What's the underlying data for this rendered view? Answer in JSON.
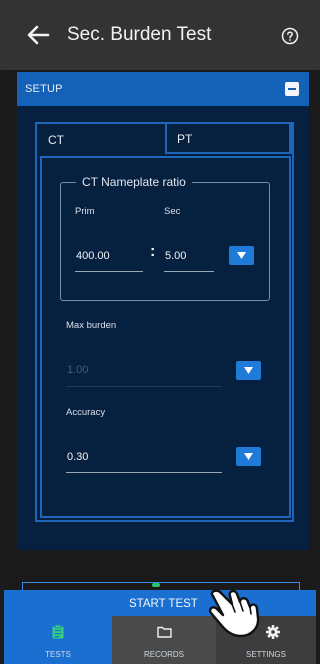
{
  "app_bar": {
    "title": "Sec. Burden Test",
    "back_icon": "arrow-left-icon",
    "help_icon": "help-circle-icon"
  },
  "setup": {
    "header": "SETUP",
    "collapse_icon": "minus-square-icon",
    "tabs": [
      {
        "label": "CT",
        "active": true
      },
      {
        "label": "PT",
        "active": false
      }
    ],
    "ct_nameplate": {
      "title": "CT Nameplate ratio",
      "prim_label": "Prim",
      "prim_value": "400.00",
      "separator": ":",
      "sec_label": "Sec",
      "sec_value": "5.00"
    },
    "max_burden": {
      "label": "Max burden",
      "value": "1.00",
      "enabled": false
    },
    "accuracy": {
      "label": "Accuracy",
      "value": "0.30"
    }
  },
  "start_button": "START TEST",
  "tab_bar": [
    {
      "label": "TESTS",
      "icon": "clipboard-icon",
      "active": true
    },
    {
      "label": "RECORDS",
      "icon": "folder-icon",
      "active": false
    },
    {
      "label": "SETTINGS",
      "icon": "gear-icon",
      "active": false
    }
  ],
  "colors": {
    "accent": "#1b6fd0",
    "panel": "#06203f",
    "header_bar": "#333333"
  }
}
